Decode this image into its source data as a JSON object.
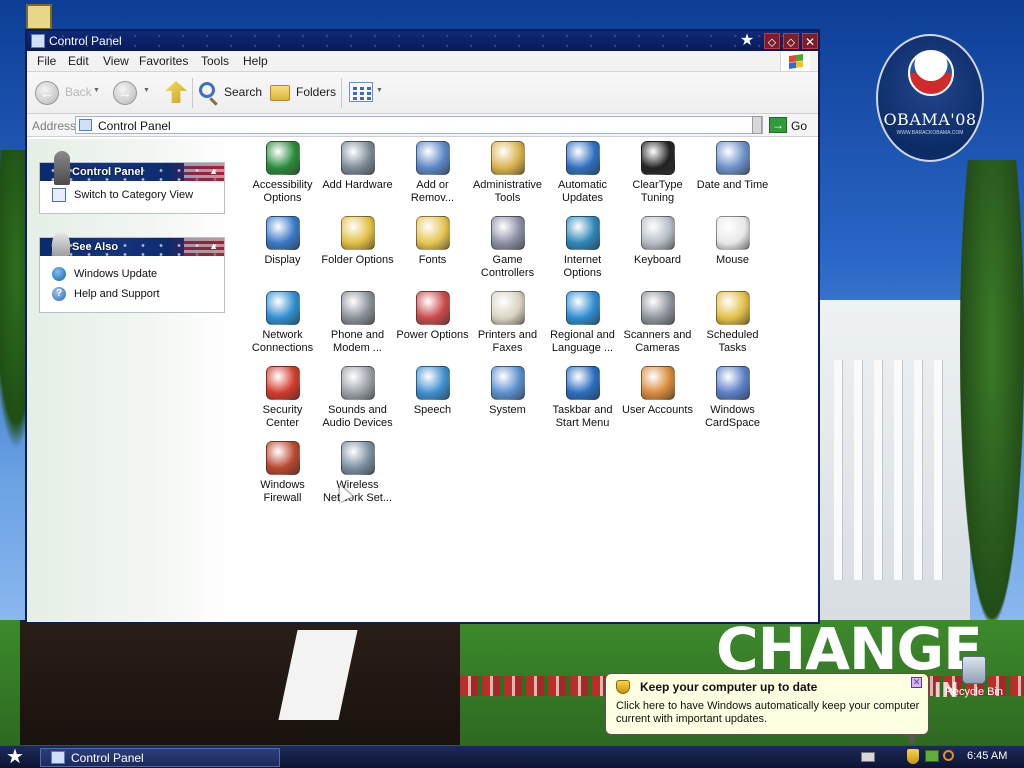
{
  "window": {
    "title": "Control Panel",
    "menu": [
      "File",
      "Edit",
      "View",
      "Favorites",
      "Tools",
      "Help"
    ],
    "toolbar": {
      "back_label": "Back",
      "search_label": "Search",
      "folders_label": "Folders"
    },
    "address": {
      "label": "Address",
      "value": "Control Panel",
      "go_label": "Go"
    }
  },
  "leftpane": {
    "control_panel_box": {
      "title": "Control Panel",
      "items": [
        {
          "label": "Switch to Category View",
          "icon": "switch-view-icon"
        }
      ]
    },
    "see_also_box": {
      "title": "See Also",
      "items": [
        {
          "label": "Windows Update",
          "icon": "windows-update-icon"
        },
        {
          "label": "Help and Support",
          "icon": "help-icon"
        }
      ]
    }
  },
  "applets": [
    {
      "label": "Accessibility Options",
      "icon": "accessibility-icon",
      "color": "#2a8a3a"
    },
    {
      "label": "Add Hardware",
      "icon": "add-hardware-icon",
      "color": "#7b8a96"
    },
    {
      "label": "Add or Remov...",
      "icon": "add-remove-programs-icon",
      "color": "#5a86c6"
    },
    {
      "label": "Administrative Tools",
      "icon": "administrative-tools-icon",
      "color": "#d8b24a"
    },
    {
      "label": "Automatic Updates",
      "icon": "automatic-updates-icon",
      "color": "#2e6fc0"
    },
    {
      "label": "ClearType Tuning",
      "icon": "cleartype-icon",
      "color": "#222222"
    },
    {
      "label": "Date and Time",
      "icon": "date-time-icon",
      "color": "#6a8fc8"
    },
    {
      "label": "Display",
      "icon": "display-icon",
      "color": "#3a78c8"
    },
    {
      "label": "Folder Options",
      "icon": "folder-options-icon",
      "color": "#e2bf45"
    },
    {
      "label": "Fonts",
      "icon": "fonts-icon",
      "color": "#e5c450"
    },
    {
      "label": "Game Controllers",
      "icon": "game-controllers-icon",
      "color": "#8c8fa4"
    },
    {
      "label": "Internet Options",
      "icon": "internet-options-icon",
      "color": "#2d86b8"
    },
    {
      "label": "Keyboard",
      "icon": "keyboard-icon",
      "color": "#b7bdc6"
    },
    {
      "label": "Mouse",
      "icon": "mouse-icon",
      "color": "#e8e8e8"
    },
    {
      "label": "Network Connections",
      "icon": "network-connections-icon",
      "color": "#2f8ed0"
    },
    {
      "label": "Phone and Modem ...",
      "icon": "phone-modem-icon",
      "color": "#8a8f98"
    },
    {
      "label": "Power Options",
      "icon": "power-options-icon",
      "color": "#c94a4a"
    },
    {
      "label": "Printers and Faxes",
      "icon": "printers-faxes-icon",
      "color": "#d9d3c0"
    },
    {
      "label": "Regional and Language ...",
      "icon": "regional-language-icon",
      "color": "#2e8bd1"
    },
    {
      "label": "Scanners and Cameras",
      "icon": "scanners-cameras-icon",
      "color": "#8f949c"
    },
    {
      "label": "Scheduled Tasks",
      "icon": "scheduled-tasks-icon",
      "color": "#e2bf45"
    },
    {
      "label": "Security Center",
      "icon": "security-center-icon",
      "color": "#d23a2a"
    },
    {
      "label": "Sounds and Audio Devices",
      "icon": "sounds-audio-icon",
      "color": "#9aa0a8"
    },
    {
      "label": "Speech",
      "icon": "speech-icon",
      "color": "#3e8fd0"
    },
    {
      "label": "System",
      "icon": "system-icon",
      "color": "#5a8fd0"
    },
    {
      "label": "Taskbar and Start Menu",
      "icon": "taskbar-start-menu-icon",
      "color": "#2a6cc0"
    },
    {
      "label": "User Accounts",
      "icon": "user-accounts-icon",
      "color": "#d88a3a"
    },
    {
      "label": "Windows CardSpace",
      "icon": "cardspace-icon",
      "color": "#5a7fc8"
    },
    {
      "label": "Windows Firewall",
      "icon": "windows-firewall-icon",
      "color": "#b9472e"
    },
    {
      "label": "Wireless Network Set...",
      "icon": "wireless-network-icon",
      "color": "#7a8fa0"
    }
  ],
  "desktop": {
    "badge_text": "OBAMA'08",
    "badge_url": "WWW.BARACKOBAMA.COM",
    "wallpaper_word": "CHANGE",
    "wallpaper_word2": "IN",
    "recycle_bin": "Recycle Bin"
  },
  "balloon": {
    "title": "Keep your computer up to date",
    "body": "Click here to have Windows automatically keep your computer current with important updates."
  },
  "taskbar": {
    "task_label": "Control Panel",
    "clock": "6:45 AM"
  }
}
